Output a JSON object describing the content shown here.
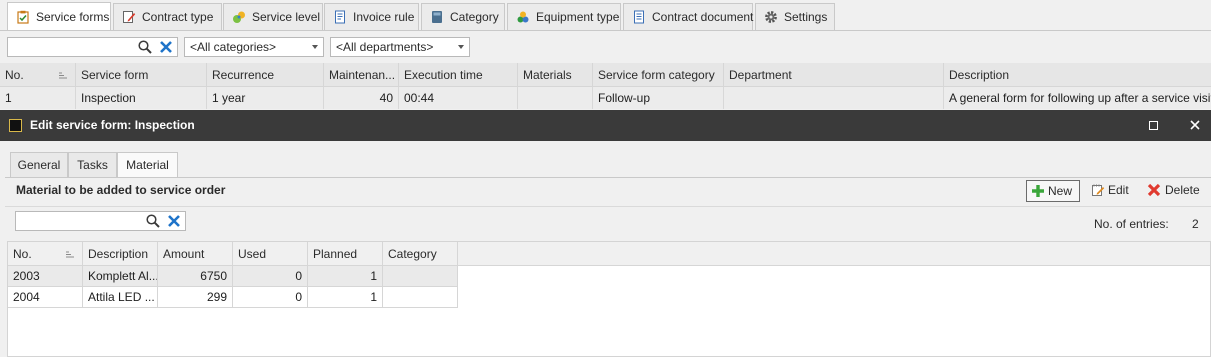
{
  "tabs": [
    {
      "label": "Service forms",
      "icon": "clipboard-check-icon",
      "active": true
    },
    {
      "label": "Contract type",
      "icon": "document-edit-icon"
    },
    {
      "label": "Service level",
      "icon": "service-level-icon"
    },
    {
      "label": "Invoice rule",
      "icon": "invoice-icon"
    },
    {
      "label": "Category",
      "icon": "category-book-icon"
    },
    {
      "label": "Equipment type",
      "icon": "equipment-icon"
    },
    {
      "label": "Contract document",
      "icon": "contract-document-icon"
    },
    {
      "label": "Settings",
      "icon": "gear-icon"
    }
  ],
  "filters": {
    "search_value": "",
    "category": "<All categories>",
    "department": "<All departments>"
  },
  "grid": {
    "columns": [
      "No.",
      "Service form",
      "Recurrence",
      "Maintenan...",
      "Execution time",
      "Materials",
      "Service form category",
      "Department",
      "Description"
    ],
    "rows": [
      [
        "1",
        "Inspection",
        "1 year",
        "40",
        "00:44",
        "",
        "Follow-up",
        "",
        "A general form for following up after a service visit."
      ]
    ]
  },
  "dialog": {
    "title": "Edit service form: Inspection",
    "tabs": [
      {
        "label": "General"
      },
      {
        "label": "Tasks"
      },
      {
        "label": "Material",
        "active": true
      }
    ],
    "panel": {
      "caption": "Material to be added to service order",
      "new_label": "New",
      "edit_label": "Edit",
      "delete_label": "Delete",
      "search_value": "",
      "entries_label": "No. of entries:",
      "entries_count": "2",
      "columns": [
        "No.",
        "Description",
        "Amount",
        "Used",
        "Planned",
        "Category"
      ],
      "rows": [
        [
          "2003",
          "Komplett Al...",
          "6750",
          "0",
          "1",
          ""
        ],
        [
          "2004",
          "Attila LED ...",
          "299",
          "0",
          "1",
          ""
        ]
      ]
    }
  },
  "colors": {
    "title_bar": "#3a3a3a",
    "delete_red": "#e03a2f",
    "new_green": "#3aa63a",
    "clear_blue": "#1e73c9"
  }
}
